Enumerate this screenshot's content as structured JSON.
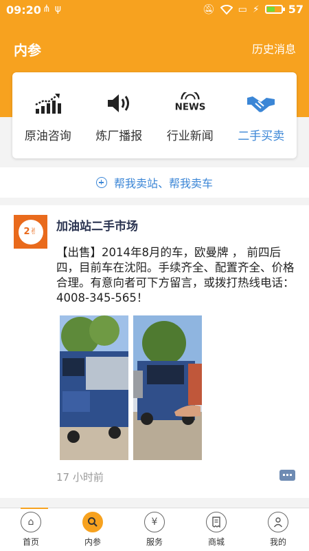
{
  "status_bar": {
    "time": "09:20",
    "battery": "57",
    "battery_level": 0.57
  },
  "header": {
    "title": "内参",
    "history_label": "历史消息"
  },
  "categories": [
    {
      "label": "原油咨询",
      "icon": "bar-chart-trend-icon"
    },
    {
      "label": "炼厂播报",
      "icon": "speaker-icon"
    },
    {
      "label": "行业新闻",
      "icon": "news-icon"
    },
    {
      "label": "二手买卖",
      "icon": "handshake-icon",
      "active": true
    }
  ],
  "sell_bar": {
    "label": "帮我卖站、帮我卖车"
  },
  "post": {
    "author": "加油站二手市场",
    "content": "【出售】2014年8月的车，欧曼牌 ， 前四后四，目前车在沈阳。手续齐全、配置齐全、价格合理。有意向者可下方留言，或拨打热线电话：4008-345-565！",
    "time": "17 小时前"
  },
  "tabs": [
    {
      "label": "首页",
      "icon": "home-icon"
    },
    {
      "label": "内参",
      "icon": "search-icon",
      "active": true
    },
    {
      "label": "服务",
      "icon": "yen-icon"
    },
    {
      "label": "商城",
      "icon": "receipt-icon"
    },
    {
      "label": "我的",
      "icon": "user-icon"
    }
  ],
  "colors": {
    "brand": "#f7a21f",
    "accent": "#3b86d6"
  }
}
